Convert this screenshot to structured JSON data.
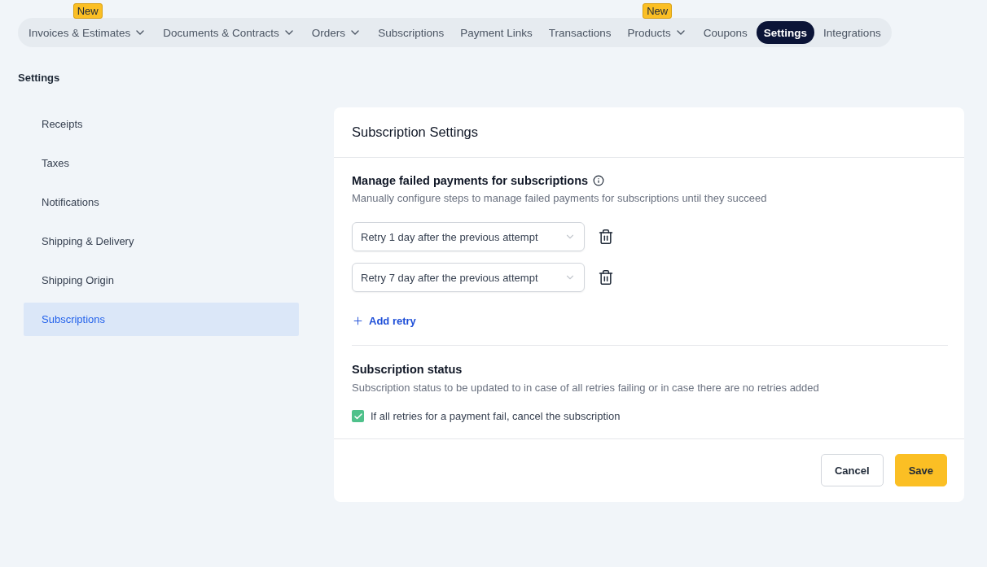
{
  "nav": [
    {
      "label": "Invoices & Estimates",
      "dropdown": true,
      "badge": "New",
      "selected": false
    },
    {
      "label": "Documents & Contracts",
      "dropdown": true,
      "selected": false
    },
    {
      "label": "Orders",
      "dropdown": true,
      "selected": false
    },
    {
      "label": "Subscriptions",
      "dropdown": false,
      "selected": false
    },
    {
      "label": "Payment Links",
      "dropdown": false,
      "selected": false
    },
    {
      "label": "Transactions",
      "dropdown": false,
      "selected": false
    },
    {
      "label": "Products",
      "dropdown": true,
      "badge": "New",
      "selected": false
    },
    {
      "label": "Coupons",
      "dropdown": false,
      "selected": false
    },
    {
      "label": "Settings",
      "dropdown": false,
      "selected": true
    },
    {
      "label": "Integrations",
      "dropdown": false,
      "selected": false
    }
  ],
  "page_title": "Settings",
  "sidebar": {
    "items": [
      {
        "label": "Receipts",
        "selected": false
      },
      {
        "label": "Taxes",
        "selected": false
      },
      {
        "label": "Notifications",
        "selected": false
      },
      {
        "label": "Shipping & Delivery",
        "selected": false
      },
      {
        "label": "Shipping Origin",
        "selected": false
      },
      {
        "label": "Subscriptions",
        "selected": true
      }
    ]
  },
  "card": {
    "title": "Subscription Settings",
    "failed_payments": {
      "title": "Manage failed payments for subscriptions",
      "description": "Manually configure steps to manage failed payments for subscriptions until they succeed",
      "retries": [
        {
          "value": "Retry 1 day after the previous attempt"
        },
        {
          "value": "Retry 7 day after the previous attempt"
        }
      ],
      "add_label": "Add retry"
    },
    "status": {
      "title": "Subscription status",
      "description": "Subscription status to be updated to in case of all retries failing or in case there are no retries added",
      "option": {
        "label": "If all retries for a payment fail, cancel the subscription",
        "checked": true
      }
    },
    "buttons": [
      {
        "label": "Cancel",
        "kind": "secondary"
      },
      {
        "label": "Save",
        "kind": "primary"
      }
    ]
  }
}
